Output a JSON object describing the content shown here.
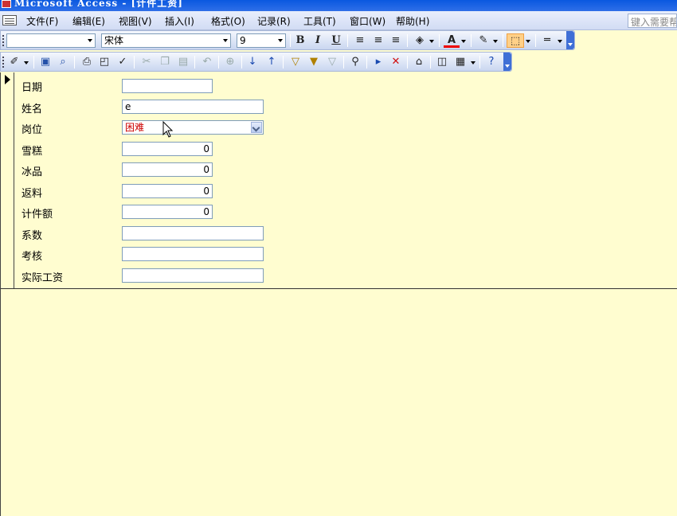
{
  "window": {
    "title": "Microsoft Access - [计件工资]"
  },
  "menubar": {
    "items": [
      {
        "label": "文件(F)"
      },
      {
        "label": "编辑(E)"
      },
      {
        "label": "视图(V)"
      },
      {
        "label": "插入(I)"
      },
      {
        "label": "格式(O)"
      },
      {
        "label": "记录(R)"
      },
      {
        "label": "工具(T)"
      },
      {
        "label": "窗口(W)"
      },
      {
        "label": "帮助(H)"
      }
    ],
    "help_placeholder": "键入需要帮助的问题"
  },
  "formatting_toolbar": {
    "object_combo": "",
    "font_name": "宋体",
    "font_size": "9",
    "bold": "B",
    "italic": "I",
    "underline": "U",
    "font_color_glyph": "A"
  },
  "form": {
    "fields": [
      {
        "label": "日期",
        "value": ""
      },
      {
        "label": "姓名",
        "value": "e"
      },
      {
        "label": "岗位",
        "value": "困难"
      },
      {
        "label": "雪糕",
        "value": "0"
      },
      {
        "label": "冰品",
        "value": "0"
      },
      {
        "label": "返料",
        "value": "0"
      },
      {
        "label": "计件额",
        "value": "0"
      },
      {
        "label": "系数",
        "value": ""
      },
      {
        "label": "考核",
        "value": ""
      },
      {
        "label": "实际工资",
        "value": ""
      }
    ]
  },
  "colors": {
    "form_background": "#fffdd0",
    "title_bar": "#0a58e0",
    "combo_text": "#cc0000"
  }
}
